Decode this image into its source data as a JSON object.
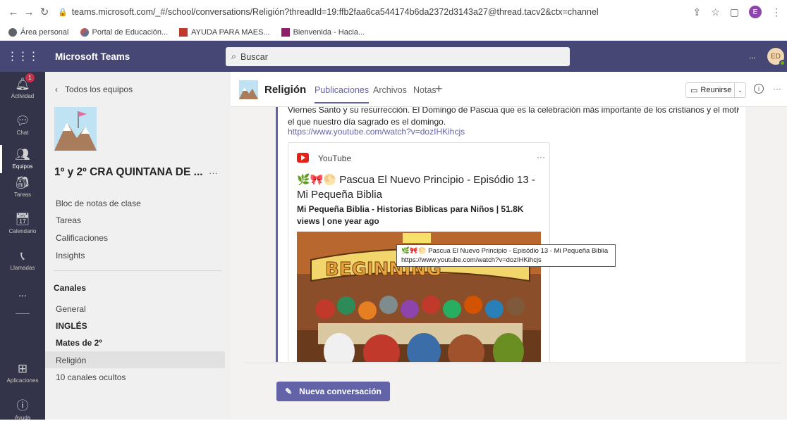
{
  "browser": {
    "url": "teams.microsoft.com/_#/school/conversations/Religión?threadId=19:ffb2faa6ca544174b6da2372d3143a27@thread.tacv2&ctx=channel",
    "profile_initial": "E",
    "bookmarks": [
      "Área personal",
      "Portal de Educación...",
      "AYUDA PARA MAES...",
      "Bienvenida - Hacia..."
    ]
  },
  "topbar": {
    "app_name": "Microsoft Teams",
    "search_placeholder": "Buscar",
    "avatar": "ED",
    "more": "..."
  },
  "rail": {
    "items": [
      {
        "label": "Actividad",
        "icon": "bell-icon",
        "badge": "1"
      },
      {
        "label": "Chat",
        "icon": "chat-icon"
      },
      {
        "label": "Equipos",
        "icon": "teams-icon"
      },
      {
        "label": "Tareas",
        "icon": "assignments-icon"
      },
      {
        "label": "Calendario",
        "icon": "calendar-icon"
      },
      {
        "label": "Llamadas",
        "icon": "phone-icon"
      },
      {
        "label": "...",
        "icon": "more-icon"
      },
      {
        "label": "Aplicaciones",
        "icon": "apps-icon"
      },
      {
        "label": "Ayuda",
        "icon": "help-icon"
      }
    ]
  },
  "panel": {
    "back": "Todos los equipos",
    "team_name": "1º y 2º CRA QUINTANA DE ...",
    "more": "···",
    "links": [
      "Bloc de notas de clase",
      "Tareas",
      "Calificaciones",
      "Insights"
    ],
    "channels_heading": "Canales",
    "channels": [
      {
        "name": "General",
        "bold": false
      },
      {
        "name": "INGLÉS",
        "bold": true
      },
      {
        "name": "Mates de 2º",
        "bold": true
      },
      {
        "name": "Religión",
        "bold": false,
        "selected": true
      },
      {
        "name": "10 canales ocultos",
        "bold": false
      }
    ]
  },
  "channel_header": {
    "name": "Religión",
    "tabs": [
      "Publicaciones",
      "Archivos",
      "Notas"
    ],
    "add": "+",
    "meet": "Reunirse",
    "more": "···"
  },
  "post": {
    "text_lines": [
      "Viernes Santo y su resurrección. El Domingo de Pascua que es la celebración más importante de los cristianos y el motivo por",
      "el que nuestro día sagrado es el domingo."
    ],
    "link": "https://www.youtube.com/watch?v=dozIHKihcjs",
    "card": {
      "source": "YouTube",
      "more": "···",
      "title": "🌿🎀🌕 Pascua El Nuevo Principio - Episódio 13 - Mi Pequeña Biblia",
      "subtitle": "Mi Pequeña Biblia - Historias Biblicas para Niños | 51.8K views | one year ago"
    }
  },
  "tooltip": {
    "title": "🌿🎀🌕 Pascua El Nuevo Principio - Episódio 13 - Mi Pequeña Biblia",
    "url": "https://www.youtube.com/watch?v=dozIHKihcjs"
  },
  "new_conversation": "Nueva conversación"
}
